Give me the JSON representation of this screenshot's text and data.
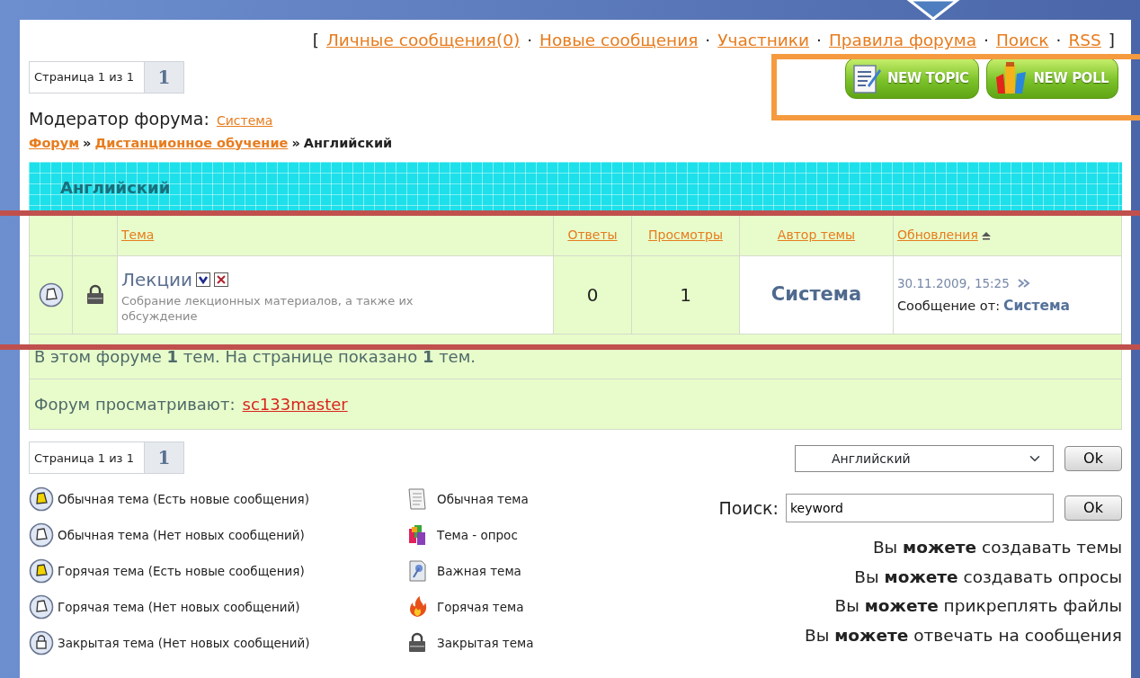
{
  "top_links": {
    "open": "[",
    "close": "]",
    "separator": "·",
    "items": [
      {
        "label": "Личные сообщения(0)"
      },
      {
        "label": "Новые сообщения"
      },
      {
        "label": "Участники"
      },
      {
        "label": "Правила форума"
      },
      {
        "label": "Поиск"
      },
      {
        "label": "RSS"
      }
    ]
  },
  "pager_top": {
    "label": "Страница 1 из 1",
    "page": "1"
  },
  "actions": [
    {
      "kind": "topic",
      "label": "NEW TOPIC"
    },
    {
      "kind": "poll",
      "label": "NEW POLL"
    }
  ],
  "moderator": {
    "label": "Модератор форума:",
    "name": "Система"
  },
  "breadcrumb": {
    "separator": "»",
    "items": [
      {
        "label": "Форум",
        "link": true
      },
      {
        "label": "Дистанционное обучение",
        "link": true
      },
      {
        "label": "Английский",
        "link": false
      }
    ]
  },
  "forum": {
    "title": "Английский",
    "columns": [
      {
        "label": "Тема",
        "sorted": false
      },
      {
        "label": "Ответы",
        "sorted": false
      },
      {
        "label": "Просмотры",
        "sorted": false
      },
      {
        "label": "Автор темы",
        "sorted": false
      },
      {
        "label": "Обновления",
        "sorted": true
      }
    ],
    "topics": [
      {
        "status_icon": {
          "kind": "read"
        },
        "type_icon": {
          "kind": "locked"
        },
        "title": "Лекции",
        "description": "Собрание лекционных материалов, а также их обсуждение",
        "replies": "0",
        "views": "1",
        "author": "Система",
        "updated": "30.11.2009, 15:25",
        "last_by_label": "Сообщение от:",
        "last_by": "Система"
      }
    ],
    "stats": "В этом форуме **1** тем. На странице показано **1** тем.",
    "viewers_label": "Форум просматривают:",
    "viewers": [
      "sc133master"
    ]
  },
  "pager_bottom": {
    "label": "Страница 1 из 1",
    "page": "1"
  },
  "jump": {
    "value": "Английский",
    "button": "Ok"
  },
  "search": {
    "label": "Поиск:",
    "value": "keyword",
    "button": "Ok"
  },
  "legend_status": [
    {
      "kind": "new",
      "label": "Обычная тема (Есть новые сообщения)"
    },
    {
      "kind": "read",
      "label": "Обычная тема (Нет новых сообщений)"
    },
    {
      "kind": "new",
      "label": "Горячая тема (Есть новые сообщения)"
    },
    {
      "kind": "read",
      "label": "Горячая тема (Нет новых сообщений)"
    },
    {
      "kind": "closed",
      "label": "Закрытая тема (Нет новых сообщений)"
    }
  ],
  "legend_types": [
    {
      "kind": "normal",
      "label": "Обычная тема"
    },
    {
      "kind": "poll",
      "label": "Тема - опрос"
    },
    {
      "kind": "sticky",
      "label": "Важная тема"
    },
    {
      "kind": "hot",
      "label": "Горячая тема"
    },
    {
      "kind": "locked",
      "label": "Закрытая тема"
    }
  ],
  "permissions": [
    "Вы **можете** создавать темы",
    "Вы **можете** создавать опросы",
    "Вы **можете** прикреплять файлы",
    "Вы **можете** отвечать на сообщения"
  ]
}
